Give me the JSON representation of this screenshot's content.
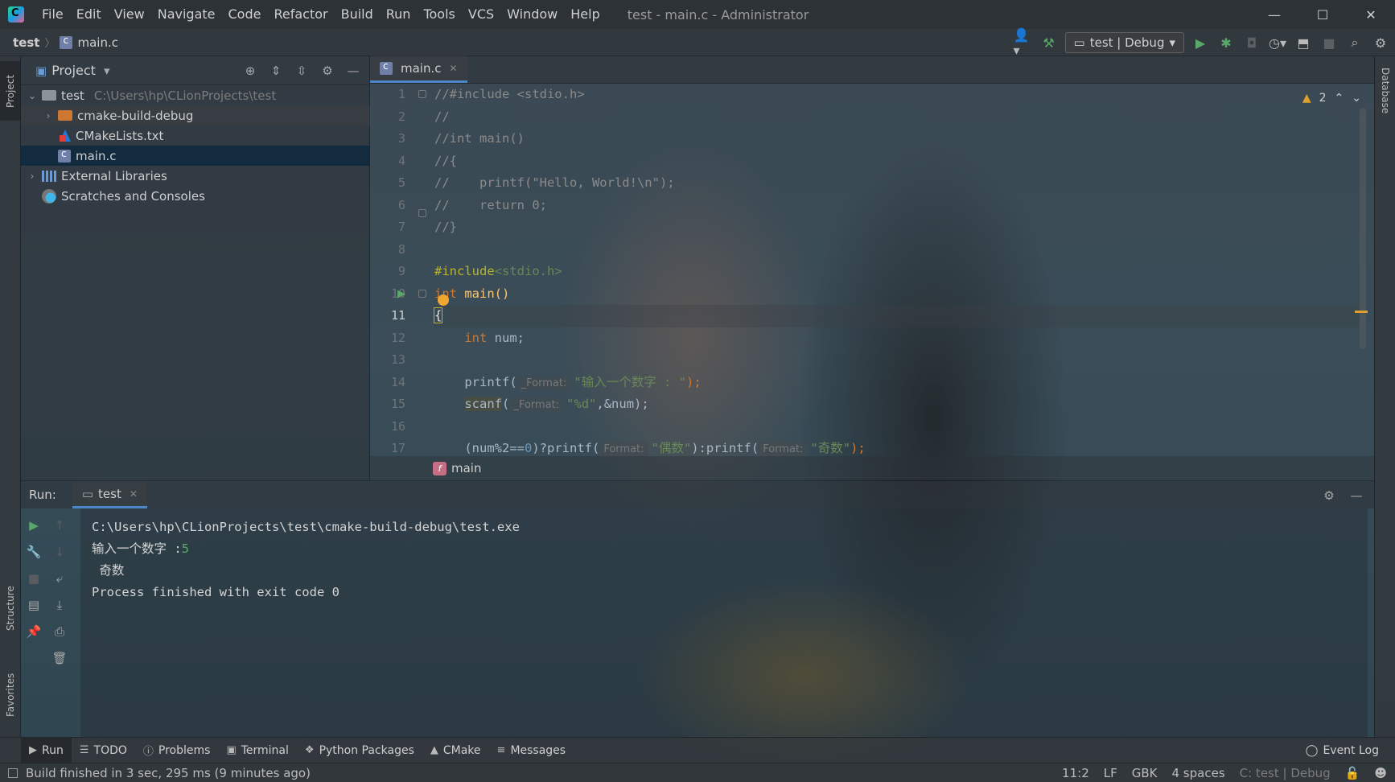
{
  "window": {
    "title": "test - main.c - Administrator",
    "menu": [
      "File",
      "Edit",
      "View",
      "Navigate",
      "Code",
      "Refactor",
      "Build",
      "Run",
      "Tools",
      "VCS",
      "Window",
      "Help"
    ],
    "controls": {
      "minimize": "—",
      "maximize": "☐",
      "close": "✕"
    }
  },
  "navbar": {
    "project": "test",
    "file": "main.c",
    "run_config": "test | Debug"
  },
  "stripes": {
    "left_top": "Project",
    "left_structure": "Structure",
    "left_favorites": "Favorites",
    "right_database": "Database"
  },
  "project_panel": {
    "title": "Project",
    "tree": [
      {
        "label": "test",
        "path": "C:\\Users\\hp\\CLionProjects\\test",
        "type": "folder-root",
        "expanded": true,
        "depth": 0
      },
      {
        "label": "cmake-build-debug",
        "type": "folder-orange",
        "expanded": false,
        "depth": 1
      },
      {
        "label": "CMakeLists.txt",
        "type": "cmake",
        "depth": 1
      },
      {
        "label": "main.c",
        "type": "c-file",
        "depth": 1,
        "selected": true
      },
      {
        "label": "External Libraries",
        "type": "libraries",
        "expanded": false,
        "depth": 0
      },
      {
        "label": "Scratches and Consoles",
        "type": "scratches",
        "depth": 0
      }
    ]
  },
  "editor": {
    "tab": "main.c",
    "warnings": "2",
    "current_line": 11,
    "line_numbers": [
      "1",
      "2",
      "3",
      "4",
      "5",
      "6",
      "7",
      "8",
      "9",
      "10",
      "11",
      "12",
      "13",
      "14",
      "15",
      "16",
      "17"
    ],
    "code": {
      "l1": "//#include <stdio.h>",
      "l2": "//",
      "l3": "//int main()",
      "l4": "//{",
      "l5": "//    printf(\"Hello, World!\\n\");",
      "l6": "//    return 0;",
      "l7": "//}",
      "l9_directive": "#include",
      "l9_header": "<stdio.h>",
      "l10_kw": "int",
      "l10_fn": "main()",
      "l11": "{",
      "l12_kw": "int",
      "l12_rest": " num;",
      "l14_fn": "printf(",
      "l14_hint": "_Format:",
      "l14_str": "\"输入一个数字 : \"",
      "l14_end": ");",
      "l15_fn": "scanf",
      "l15_open": "(",
      "l15_hint": "_Format:",
      "l15_str": "\"%d\"",
      "l15_rest": ",&num);",
      "l17_a": "(num%2==",
      "l17_num": "0",
      "l17_b": ")?printf(",
      "l17_hint1": "Format:",
      "l17_str1": "\"偶数\"",
      "l17_c": "):printf(",
      "l17_hint2": "Format:",
      "l17_str2": "\"奇数\"",
      "l17_end": ");"
    },
    "breadcrumb": "main"
  },
  "run_panel": {
    "label": "Run:",
    "tab": "test",
    "console": {
      "path": "C:\\Users\\hp\\CLionProjects\\test\\cmake-build-debug\\test.exe",
      "prompt": "输入一个数字 :",
      "input": "5",
      "result": " 奇数",
      "finished": "Process finished with exit code 0"
    }
  },
  "bottom_tools": [
    "Run",
    "TODO",
    "Problems",
    "Terminal",
    "Python Packages",
    "CMake",
    "Messages"
  ],
  "event_log": "Event Log",
  "status": {
    "message": "Build finished in 3 sec, 295 ms (9 minutes ago)",
    "position": "11:2",
    "line_sep": "LF",
    "encoding": "GBK",
    "indent": "4 spaces",
    "context": "C: test | Debug"
  },
  "colors": {
    "accent": "#4a88c7",
    "run_green": "#59a869",
    "keyword": "#cc7832",
    "string": "#6a8759",
    "function": "#ffc66d",
    "warning": "#e0a030"
  }
}
